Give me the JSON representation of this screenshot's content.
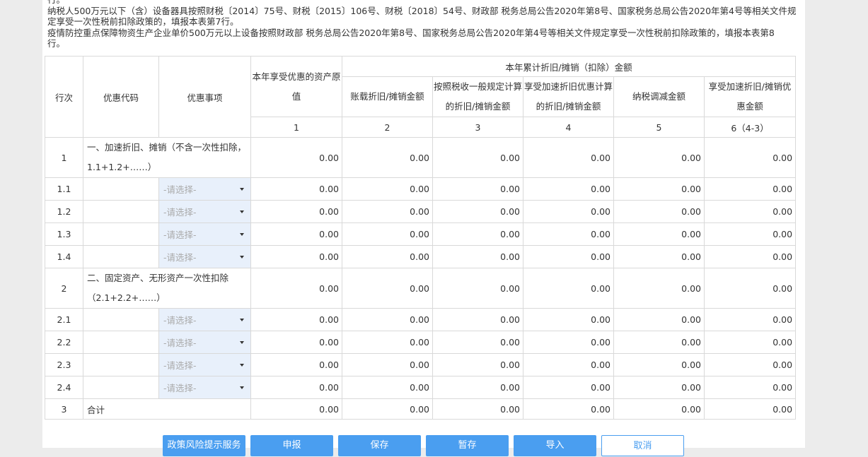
{
  "notes": [
    "行。",
    "纳税人500万元以下（含）设备器具按照财税〔2014〕75号、财税〔2015〕106号、财税〔2018〕54号、财政部 税务总局公告2020年第8号、国家税务总局公告2020年第4号等相关文件规",
    "定享受一次性税前扣除政策的，填报本表第7行。",
    "疫情防控重点保障物资生产企业单价500万元以上设备按照财政部 税务总局公告2020年第8号、国家税务总局公告2020年第4号等相关文件规定享受一次性税前扣除政策的，填报本表第8",
    "行。"
  ],
  "headers": {
    "row_no": "行次",
    "code": "优惠代码",
    "item": "优惠事项",
    "asset_value": "本年享受优惠的资产原值",
    "group": "本年累计折旧/摊销（扣除）金额",
    "c2": "账载折旧/摊销金额",
    "c3": "按照税收一般规定计算的折旧/摊销金额",
    "c4": "享受加速折旧优惠计算的折旧/摊销金额",
    "c5": "纳税调减金额",
    "c6": "享受加速折旧/摊销优惠金额",
    "n1": "1",
    "n2": "2",
    "n3": "3",
    "n4": "4",
    "n5": "5",
    "n6": "6（4-3）"
  },
  "select_placeholder": "-请选择-",
  "rows": [
    {
      "no": "1",
      "name": "一、加速折旧、摊销（不含一次性扣除，1.1+1.2+……）",
      "v": [
        "0.00",
        "0.00",
        "0.00",
        "0.00",
        "0.00",
        "0.00"
      ]
    },
    {
      "no": "1.1",
      "v": [
        "0.00",
        "0.00",
        "0.00",
        "0.00",
        "0.00",
        "0.00"
      ]
    },
    {
      "no": "1.2",
      "v": [
        "0.00",
        "0.00",
        "0.00",
        "0.00",
        "0.00",
        "0.00"
      ]
    },
    {
      "no": "1.3",
      "v": [
        "0.00",
        "0.00",
        "0.00",
        "0.00",
        "0.00",
        "0.00"
      ]
    },
    {
      "no": "1.4",
      "v": [
        "0.00",
        "0.00",
        "0.00",
        "0.00",
        "0.00",
        "0.00"
      ]
    },
    {
      "no": "2",
      "name": "二、固定资产、无形资产一次性扣除（2.1+2.2+……）",
      "v": [
        "0.00",
        "0.00",
        "0.00",
        "0.00",
        "0.00",
        "0.00"
      ]
    },
    {
      "no": "2.1",
      "v": [
        "0.00",
        "0.00",
        "0.00",
        "0.00",
        "0.00",
        "0.00"
      ]
    },
    {
      "no": "2.2",
      "v": [
        "0.00",
        "0.00",
        "0.00",
        "0.00",
        "0.00",
        "0.00"
      ]
    },
    {
      "no": "2.3",
      "v": [
        "0.00",
        "0.00",
        "0.00",
        "0.00",
        "0.00",
        "0.00"
      ]
    },
    {
      "no": "2.4",
      "v": [
        "0.00",
        "0.00",
        "0.00",
        "0.00",
        "0.00",
        "0.00"
      ]
    },
    {
      "no": "3",
      "name": "合计",
      "v": [
        "0.00",
        "0.00",
        "0.00",
        "0.00",
        "0.00",
        "0.00"
      ]
    }
  ],
  "buttons": {
    "policy_risk": "政策风险提示服务",
    "declare": "申报",
    "save": "保存",
    "temp_save": "暂存",
    "import": "导入",
    "cancel": "取消"
  }
}
